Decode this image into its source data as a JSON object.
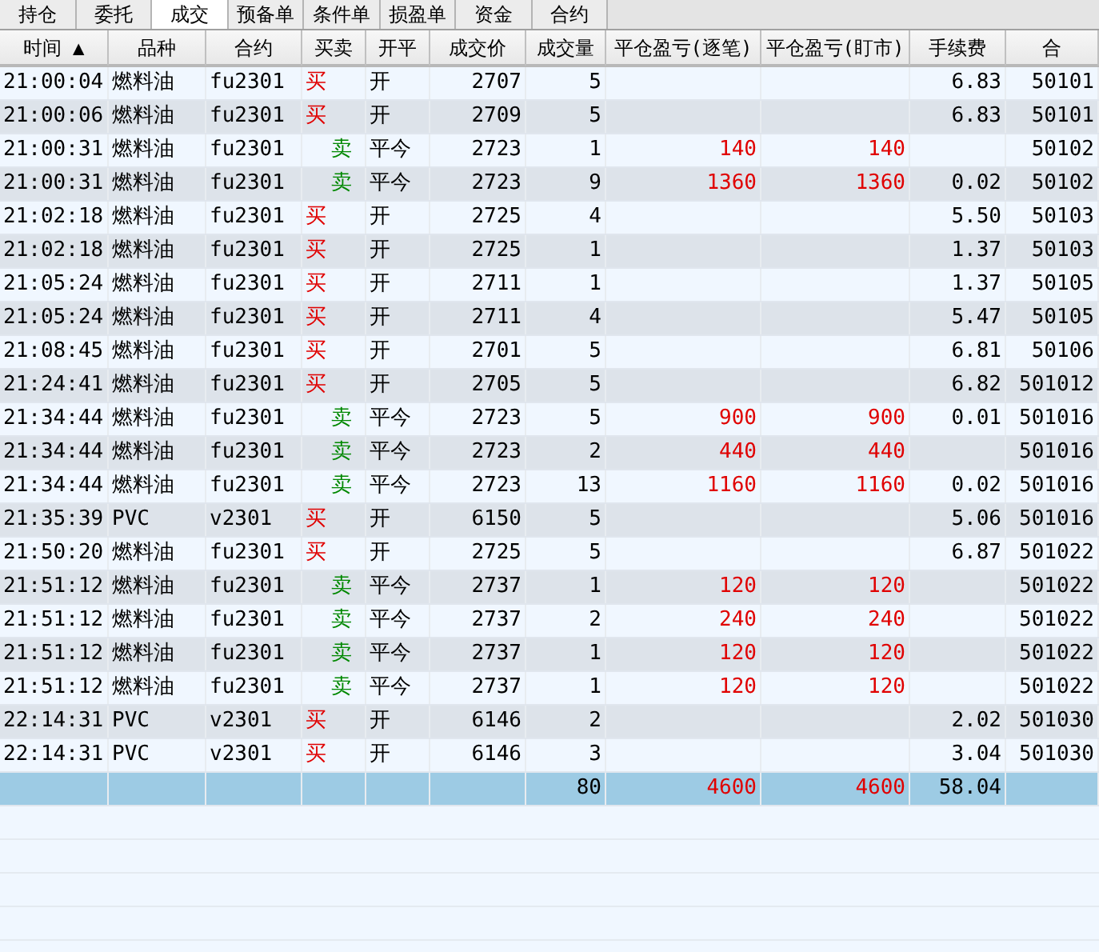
{
  "tabs": [
    {
      "label": "持仓",
      "selected": false
    },
    {
      "label": "委托",
      "selected": false
    },
    {
      "label": "成交",
      "selected": true
    },
    {
      "label": "预备单",
      "selected": false
    },
    {
      "label": "条件单",
      "selected": false
    },
    {
      "label": "损盈单",
      "selected": false
    },
    {
      "label": "资金",
      "selected": false
    },
    {
      "label": "合约",
      "selected": false
    }
  ],
  "table": {
    "columns": [
      "时间 ▲",
      "品种",
      "合约",
      "买卖",
      "开平",
      "成交价",
      "成交量",
      "平仓盈亏(逐笔)",
      "平仓盈亏(盯市)",
      "手续费",
      "合"
    ],
    "rows": [
      {
        "time": "21:00:04",
        "product": "燃料油",
        "contract": "fu2301",
        "side": {
          "kind": "buy",
          "label": "买"
        },
        "offset": "开",
        "price": "2707",
        "qty": "5",
        "fee": "6.83",
        "column_11": "50101"
      },
      {
        "time": "21:00:06",
        "product": "燃料油",
        "contract": "fu2301",
        "side": {
          "kind": "buy",
          "label": "买"
        },
        "offset": "开",
        "price": "2709",
        "qty": "5",
        "fee": "6.83",
        "column_11": "50101"
      },
      {
        "time": "21:00:31",
        "product": "燃料油",
        "contract": "fu2301",
        "side": {
          "kind": "sell",
          "label": "卖"
        },
        "offset": "平今",
        "price": "2723",
        "qty": "1",
        "pnl_trade": "140",
        "pnl_mtm": "140",
        "column_11": "50102"
      },
      {
        "time": "21:00:31",
        "product": "燃料油",
        "contract": "fu2301",
        "side": {
          "kind": "sell",
          "label": "卖"
        },
        "offset": "平今",
        "price": "2723",
        "qty": "9",
        "pnl_trade": "1360",
        "pnl_mtm": "1360",
        "fee": "0.02",
        "column_11": "50102"
      },
      {
        "time": "21:02:18",
        "product": "燃料油",
        "contract": "fu2301",
        "side": {
          "kind": "buy",
          "label": "买"
        },
        "offset": "开",
        "price": "2725",
        "qty": "4",
        "fee": "5.50",
        "column_11": "50103"
      },
      {
        "time": "21:02:18",
        "product": "燃料油",
        "contract": "fu2301",
        "side": {
          "kind": "buy",
          "label": "买"
        },
        "offset": "开",
        "price": "2725",
        "qty": "1",
        "fee": "1.37",
        "column_11": "50103"
      },
      {
        "time": "21:05:24",
        "product": "燃料油",
        "contract": "fu2301",
        "side": {
          "kind": "buy",
          "label": "买"
        },
        "offset": "开",
        "price": "2711",
        "qty": "1",
        "fee": "1.37",
        "column_11": "50105"
      },
      {
        "time": "21:05:24",
        "product": "燃料油",
        "contract": "fu2301",
        "side": {
          "kind": "buy",
          "label": "买"
        },
        "offset": "开",
        "price": "2711",
        "qty": "4",
        "fee": "5.47",
        "column_11": "50105"
      },
      {
        "time": "21:08:45",
        "product": "燃料油",
        "contract": "fu2301",
        "side": {
          "kind": "buy",
          "label": "买"
        },
        "offset": "开",
        "price": "2701",
        "qty": "5",
        "fee": "6.81",
        "column_11": "50106"
      },
      {
        "time": "21:24:41",
        "product": "燃料油",
        "contract": "fu2301",
        "side": {
          "kind": "buy",
          "label": "买"
        },
        "offset": "开",
        "price": "2705",
        "qty": "5",
        "fee": "6.82",
        "column_11": "501012"
      },
      {
        "time": "21:34:44",
        "product": "燃料油",
        "contract": "fu2301",
        "side": {
          "kind": "sell",
          "label": "卖"
        },
        "offset": "平今",
        "price": "2723",
        "qty": "5",
        "pnl_trade": "900",
        "pnl_mtm": "900",
        "fee": "0.01",
        "column_11": "501016"
      },
      {
        "time": "21:34:44",
        "product": "燃料油",
        "contract": "fu2301",
        "side": {
          "kind": "sell",
          "label": "卖"
        },
        "offset": "平今",
        "price": "2723",
        "qty": "2",
        "pnl_trade": "440",
        "pnl_mtm": "440",
        "column_11": "501016"
      },
      {
        "time": "21:34:44",
        "product": "燃料油",
        "contract": "fu2301",
        "side": {
          "kind": "sell",
          "label": "卖"
        },
        "offset": "平今",
        "price": "2723",
        "qty": "13",
        "pnl_trade": "1160",
        "pnl_mtm": "1160",
        "fee": "0.02",
        "column_11": "501016"
      },
      {
        "time": "21:35:39",
        "product": "PVC",
        "contract": "v2301",
        "side": {
          "kind": "buy",
          "label": "买"
        },
        "offset": "开",
        "price": "6150",
        "qty": "5",
        "fee": "5.06",
        "column_11": "501016"
      },
      {
        "time": "21:50:20",
        "product": "燃料油",
        "contract": "fu2301",
        "side": {
          "kind": "buy",
          "label": "买"
        },
        "offset": "开",
        "price": "2725",
        "qty": "5",
        "fee": "6.87",
        "column_11": "501022"
      },
      {
        "time": "21:51:12",
        "product": "燃料油",
        "contract": "fu2301",
        "side": {
          "kind": "sell",
          "label": "卖"
        },
        "offset": "平今",
        "price": "2737",
        "qty": "1",
        "pnl_trade": "120",
        "pnl_mtm": "120",
        "column_11": "501022"
      },
      {
        "time": "21:51:12",
        "product": "燃料油",
        "contract": "fu2301",
        "side": {
          "kind": "sell",
          "label": "卖"
        },
        "offset": "平今",
        "price": "2737",
        "qty": "2",
        "pnl_trade": "240",
        "pnl_mtm": "240",
        "column_11": "501022"
      },
      {
        "time": "21:51:12",
        "product": "燃料油",
        "contract": "fu2301",
        "side": {
          "kind": "sell",
          "label": "卖"
        },
        "offset": "平今",
        "price": "2737",
        "qty": "1",
        "pnl_trade": "120",
        "pnl_mtm": "120",
        "column_11": "501022"
      },
      {
        "time": "21:51:12",
        "product": "燃料油",
        "contract": "fu2301",
        "side": {
          "kind": "sell",
          "label": "卖"
        },
        "offset": "平今",
        "price": "2737",
        "qty": "1",
        "pnl_trade": "120",
        "pnl_mtm": "120",
        "column_11": "501022"
      },
      {
        "time": "22:14:31",
        "product": "PVC",
        "contract": "v2301",
        "side": {
          "kind": "buy",
          "label": "买"
        },
        "offset": "开",
        "price": "6146",
        "qty": "2",
        "fee": "2.02",
        "column_11": "501030"
      },
      {
        "time": "22:14:31",
        "product": "PVC",
        "contract": "v2301",
        "side": {
          "kind": "buy",
          "label": "买"
        },
        "offset": "开",
        "price": "6146",
        "qty": "3",
        "fee": "3.04",
        "column_11": "501030"
      }
    ],
    "total": {
      "qty": "80",
      "pnl_trade": "4600",
      "pnl_mtm": "4600",
      "fee": "58.04"
    }
  }
}
